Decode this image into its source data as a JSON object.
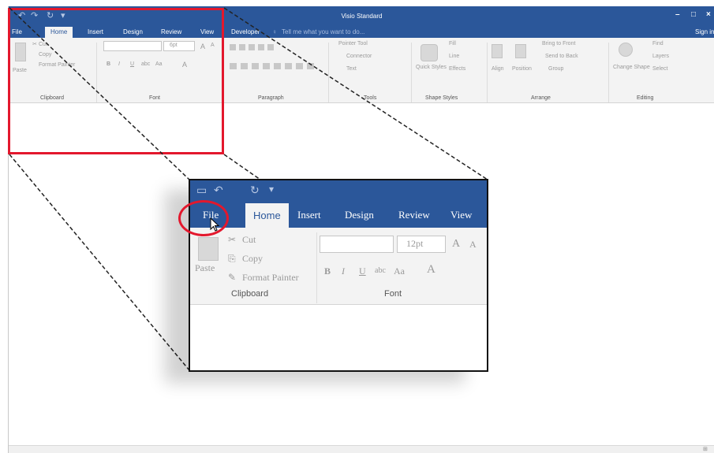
{
  "window": {
    "title": "Visio Standard",
    "qat": [
      "↶",
      "↷",
      "↻",
      "▾"
    ],
    "controls": {
      "minimize": "–",
      "restore": "□",
      "close": "×"
    },
    "sign_in": "Sign in"
  },
  "tabs": [
    "File",
    "Home",
    "Insert",
    "Design",
    "Review",
    "View",
    "Developer"
  ],
  "tell_me": "Tell me what you want to do...",
  "ribbon": {
    "clipboard": {
      "paste": "Paste",
      "cut": "Cut",
      "copy": "Copy",
      "format_painter": "Format Painter",
      "label": "Clipboard"
    },
    "font": {
      "size": "6pt",
      "grow": "A",
      "shrink": "A",
      "bold": "B",
      "italic": "I",
      "underline": "U",
      "strike": "abc",
      "case": "Aa",
      "color": "A",
      "label": "Font"
    },
    "paragraph": {
      "label": "Paragraph"
    },
    "tools": {
      "pointer": "Pointer Tool",
      "connector": "Connector",
      "text": "Text",
      "label": "Tools"
    },
    "shape_styles": {
      "quick_styles": "Quick Styles",
      "fill": "Fill",
      "line": "Line",
      "effects": "Effects",
      "label": "Shape Styles"
    },
    "arrange": {
      "align": "Align",
      "position": "Position",
      "bring_front": "Bring to Front",
      "send_back": "Send to Back",
      "group": "Group",
      "label": "Arrange"
    },
    "editing": {
      "change_shape": "Change Shape",
      "find": "Find",
      "layers": "Layers",
      "select": "Select",
      "label": "Editing"
    }
  },
  "zoom": {
    "tabs": [
      "File",
      "Home",
      "Insert",
      "Design",
      "Review",
      "View"
    ],
    "paste": "Paste",
    "cut": "Cut",
    "copy": "Copy",
    "format_painter": "Format Painter",
    "clipboard_label": "Clipboard",
    "font_size": "12pt",
    "grow": "A",
    "shrink": "A",
    "bold": "B",
    "italic": "I",
    "underline": "U",
    "strike": "abc",
    "case": "Aa",
    "color": "A",
    "font_label": "Font"
  },
  "colors": {
    "brand": "#2b579a",
    "highlight": "#e3182d",
    "ribbon": "#f3f3f3"
  },
  "icons": [
    "paste-icon",
    "cut-icon",
    "copy-icon",
    "format-painter-icon",
    "cursor-icon",
    "lightbulb-icon"
  ]
}
